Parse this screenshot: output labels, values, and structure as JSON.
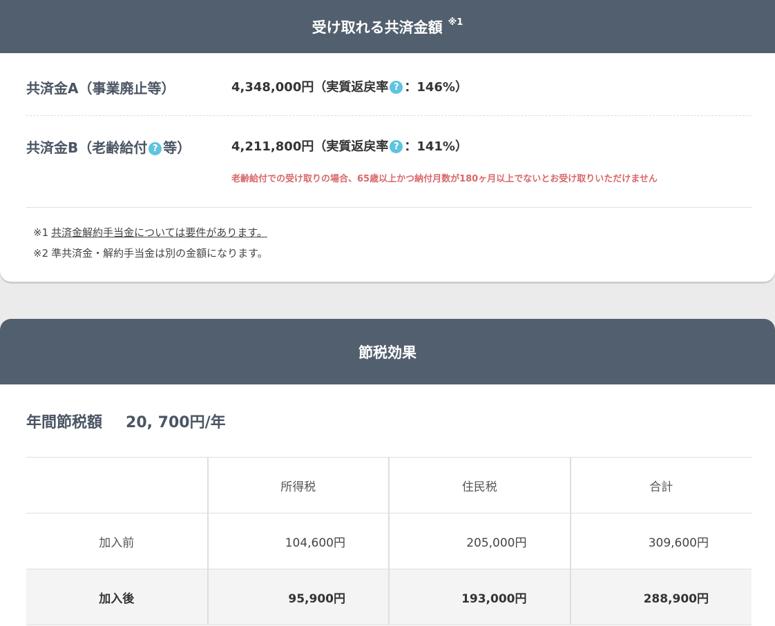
{
  "benefits": {
    "title": "受け取れる共済金額",
    "title_note": "※1",
    "help_icon": "question-circle-icon",
    "a": {
      "label": "共済金A（事業廃止等）",
      "amount": "4,348,000円（実質返戻率",
      "rate": "：146%）"
    },
    "b": {
      "label_pre": "共済金B（老齢給付",
      "label_post": "等）",
      "amount": "4,211,800円（実質返戻率",
      "rate": "：141%）",
      "warning": "老齢給付での受け取りの場合、65歳以上かつ納付月数が180ヶ月以上でないとお受け取りいただけません"
    },
    "notes": [
      {
        "mark": "※1",
        "text": "共済金解約手当金については要件があります。"
      },
      {
        "mark": "※2",
        "text": "準共済金・解約手当金は別の金額になります。"
      }
    ]
  },
  "tax_savings": {
    "title": "節税効果",
    "annual_label": "年間節税額",
    "annual_value": "20, 700円/年",
    "columns": [
      "",
      "所得税",
      "住民税",
      "合計"
    ],
    "rows": [
      {
        "label": "加入前",
        "income": "104,600円",
        "resident": "205,000円",
        "total": "309,600円"
      },
      {
        "label": "加入後",
        "income": "95,900円",
        "resident": "193,000円",
        "total": "288,900円"
      }
    ]
  },
  "colors": {
    "header_bg": "#525f6e",
    "help_icon": "#5ec4e0",
    "warning": "#d9676a"
  }
}
